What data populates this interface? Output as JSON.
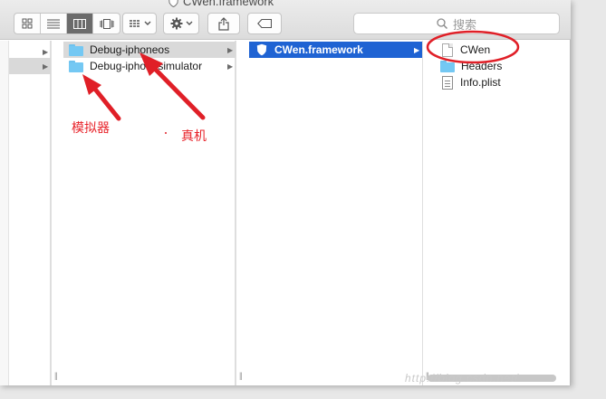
{
  "window": {
    "title": "CWen.framework"
  },
  "toolbar": {
    "view_buttons": [
      {
        "name": "icon-view",
        "selected": false
      },
      {
        "name": "list-view",
        "selected": false
      },
      {
        "name": "column-view",
        "selected": true
      },
      {
        "name": "cover-flow-view",
        "selected": false
      }
    ],
    "search_placeholder": "搜索"
  },
  "columns": {
    "col2": [
      {
        "label": "Debug-iphoneos",
        "type": "folder",
        "highlighted": true,
        "has_children": true
      },
      {
        "label": "Debug-iphonesimulator",
        "type": "folder",
        "highlighted": false,
        "has_children": true
      }
    ],
    "col3": [
      {
        "label": "CWen.framework",
        "type": "framework",
        "selected": true,
        "has_children": true
      }
    ],
    "col4": [
      {
        "label": "CWen",
        "type": "document"
      },
      {
        "label": "Headers",
        "type": "folder"
      },
      {
        "label": "Info.plist",
        "type": "plist"
      }
    ]
  },
  "annotations": {
    "simulator": "模拟器",
    "device": "真机"
  },
  "watermark": "http://blog.csdn.net/",
  "colors": {
    "selection": "#1f63d3",
    "annotation": "#e8232a",
    "folder": "#74c8f3"
  }
}
